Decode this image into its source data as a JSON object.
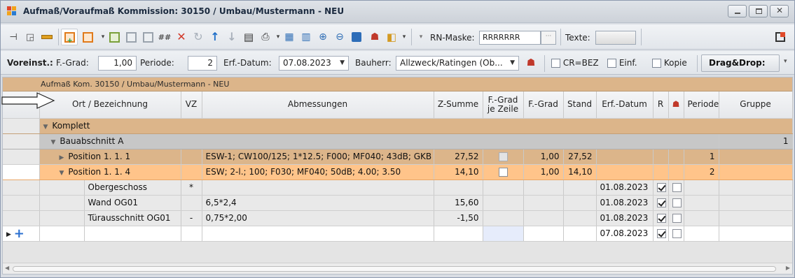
{
  "window": {
    "title": "Aufmaß/Voraufmaß Kommission: 30150 / Umbau/Mustermann - NEU"
  },
  "toolbar": {
    "rn_mask_label": "RN-Maske:",
    "rn_mask_value": "RRRRRRR",
    "rn_mask_button": "···",
    "texte_label": "Texte:",
    "hash_label": "##"
  },
  "settings": {
    "voreinst_label": "Voreinst.:",
    "fgrad_label": "F.-Grad:",
    "fgrad_value": "1,00",
    "periode_label": "Periode:",
    "periode_value": "2",
    "erfdatum_label": "Erf.-Datum:",
    "erfdatum_value": "07.08.2023",
    "bauherr_label": "Bauherr:",
    "bauherr_value": "Allzweck/Ratingen  (Ob...",
    "crbez_label": "CR=BEZ",
    "einf_label": "Einf.",
    "kopie_label": "Kopie",
    "dragdrop_label": "Drag&Drop:"
  },
  "grid": {
    "caption": "Aufmaß Kom. 30150 / Umbau/Mustermann - NEU",
    "columns": {
      "ort": "Ort / Bezeichnung",
      "vz": "VZ",
      "abmessungen": "Abmessungen",
      "zsumme": "Z-Summe",
      "fgrad_zeile_1": "F.-Grad",
      "fgrad_zeile_2": "je Zeile",
      "fgrad": "F.-Grad",
      "stand": "Stand",
      "erfdatum": "Erf.-Datum",
      "r": "R",
      "periode": "Periode",
      "gruppe": "Gruppe"
    },
    "group_komplett": "Komplett",
    "group_bau": "Bauabschnitt A",
    "group_bau_count": "1",
    "rows": {
      "pos1": {
        "ort": "Position  1. 1.  1",
        "abm": "ESW-1; CW100/125; 1*12.5; F000; MF040; 43dB; GKB",
        "zsumme": "27,52",
        "fgrad": "1,00",
        "stand": "27,52",
        "periode": "1"
      },
      "pos4": {
        "ort": "Position  1. 1.  4",
        "abm": "ESW; 2-l.; 100; F030; MF040; 50dB; 4.00; 3.50",
        "zsumme": "14,10",
        "fgrad": "1,00",
        "stand": "14,10",
        "periode": "2"
      },
      "og": {
        "ort": "Obergeschoss",
        "vz": "*",
        "erf": "01.08.2023"
      },
      "wand": {
        "ort": "Wand OG01",
        "abm": "6,5*2,4",
        "zsumme": "15,60",
        "erf": "01.08.2023"
      },
      "tuer": {
        "ort": "Türausschnitt OG01",
        "vz": "-",
        "abm": "0,75*2,00",
        "zsumme": "-1,50",
        "erf": "01.08.2023"
      },
      "new": {
        "erf": "07.08.2023"
      }
    }
  },
  "colors": {
    "group_orange": "#dcb58a",
    "selected_row": "#ffc48a",
    "window_bg": "#d9dde3"
  }
}
